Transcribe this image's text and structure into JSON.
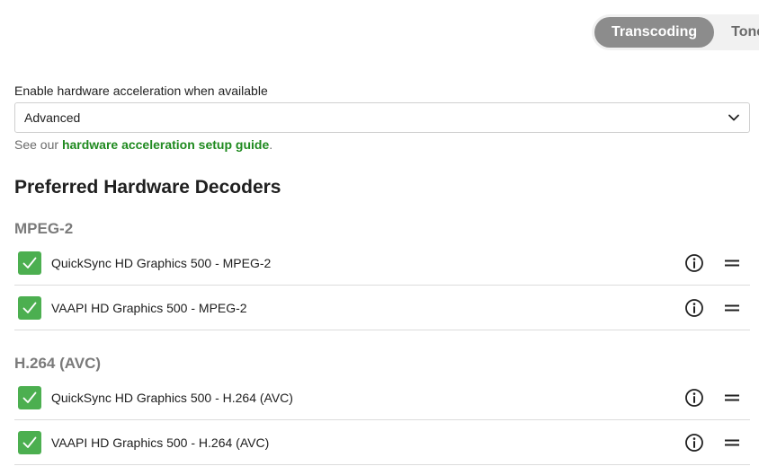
{
  "tabs": [
    {
      "label": "Transcoding",
      "active": true
    },
    {
      "label": "Tone Mapping",
      "active": false
    }
  ],
  "hw_accel": {
    "label": "Enable hardware acceleration when available",
    "value": "Advanced",
    "help_prefix": "See our ",
    "help_link": "hardware acceleration setup guide",
    "help_suffix": "."
  },
  "decoders": {
    "title": "Preferred Hardware Decoders",
    "groups": [
      {
        "name": "MPEG-2",
        "items": [
          {
            "label": "QuickSync HD Graphics 500 - MPEG-2",
            "checked": true
          },
          {
            "label": "VAAPI HD Graphics 500 - MPEG-2",
            "checked": true
          }
        ]
      },
      {
        "name": "H.264 (AVC)",
        "items": [
          {
            "label": "QuickSync HD Graphics 500 - H.264 (AVC)",
            "checked": true
          },
          {
            "label": "VAAPI HD Graphics 500 - H.264 (AVC)",
            "checked": true
          }
        ]
      }
    ]
  },
  "colors": {
    "checkbox": "#4caf50",
    "link": "#1f8a1f",
    "active_tab": "#8c8c8c"
  },
  "icons": {
    "info": "info-icon",
    "drag": "drag-handle-icon",
    "check": "check-icon",
    "chevron": "chevron-down-icon"
  }
}
